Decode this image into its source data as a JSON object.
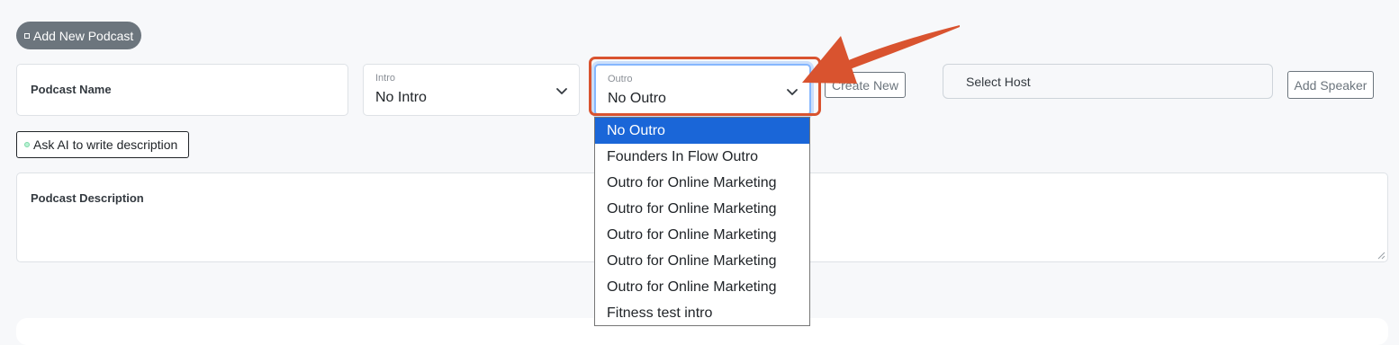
{
  "toolbar": {
    "add_podcast_label": "Add New Podcast"
  },
  "podcast_name": {
    "label": "Podcast Name"
  },
  "intro": {
    "caption": "Intro",
    "value": "No Intro"
  },
  "outro": {
    "caption": "Outro",
    "value": "No Outro",
    "options": [
      "No Outro",
      "Founders In Flow Outro",
      "Outro for Online Marketing",
      "Outro for Online Marketing",
      "Outro for Online Marketing",
      "Outro for Online Marketing",
      "Outro for Online Marketing",
      "Fitness test intro"
    ],
    "selected_index": 0
  },
  "create_new_label": "Create New",
  "host": {
    "placeholder": "Select Host"
  },
  "add_speaker_label": "Add Speaker",
  "ai_button_label": "Ask AI to write description",
  "description": {
    "label": "Podcast Description"
  },
  "colors": {
    "highlight": "#d9532f",
    "selected_option": "#1a66d8",
    "pill_button": "#6c757d"
  }
}
